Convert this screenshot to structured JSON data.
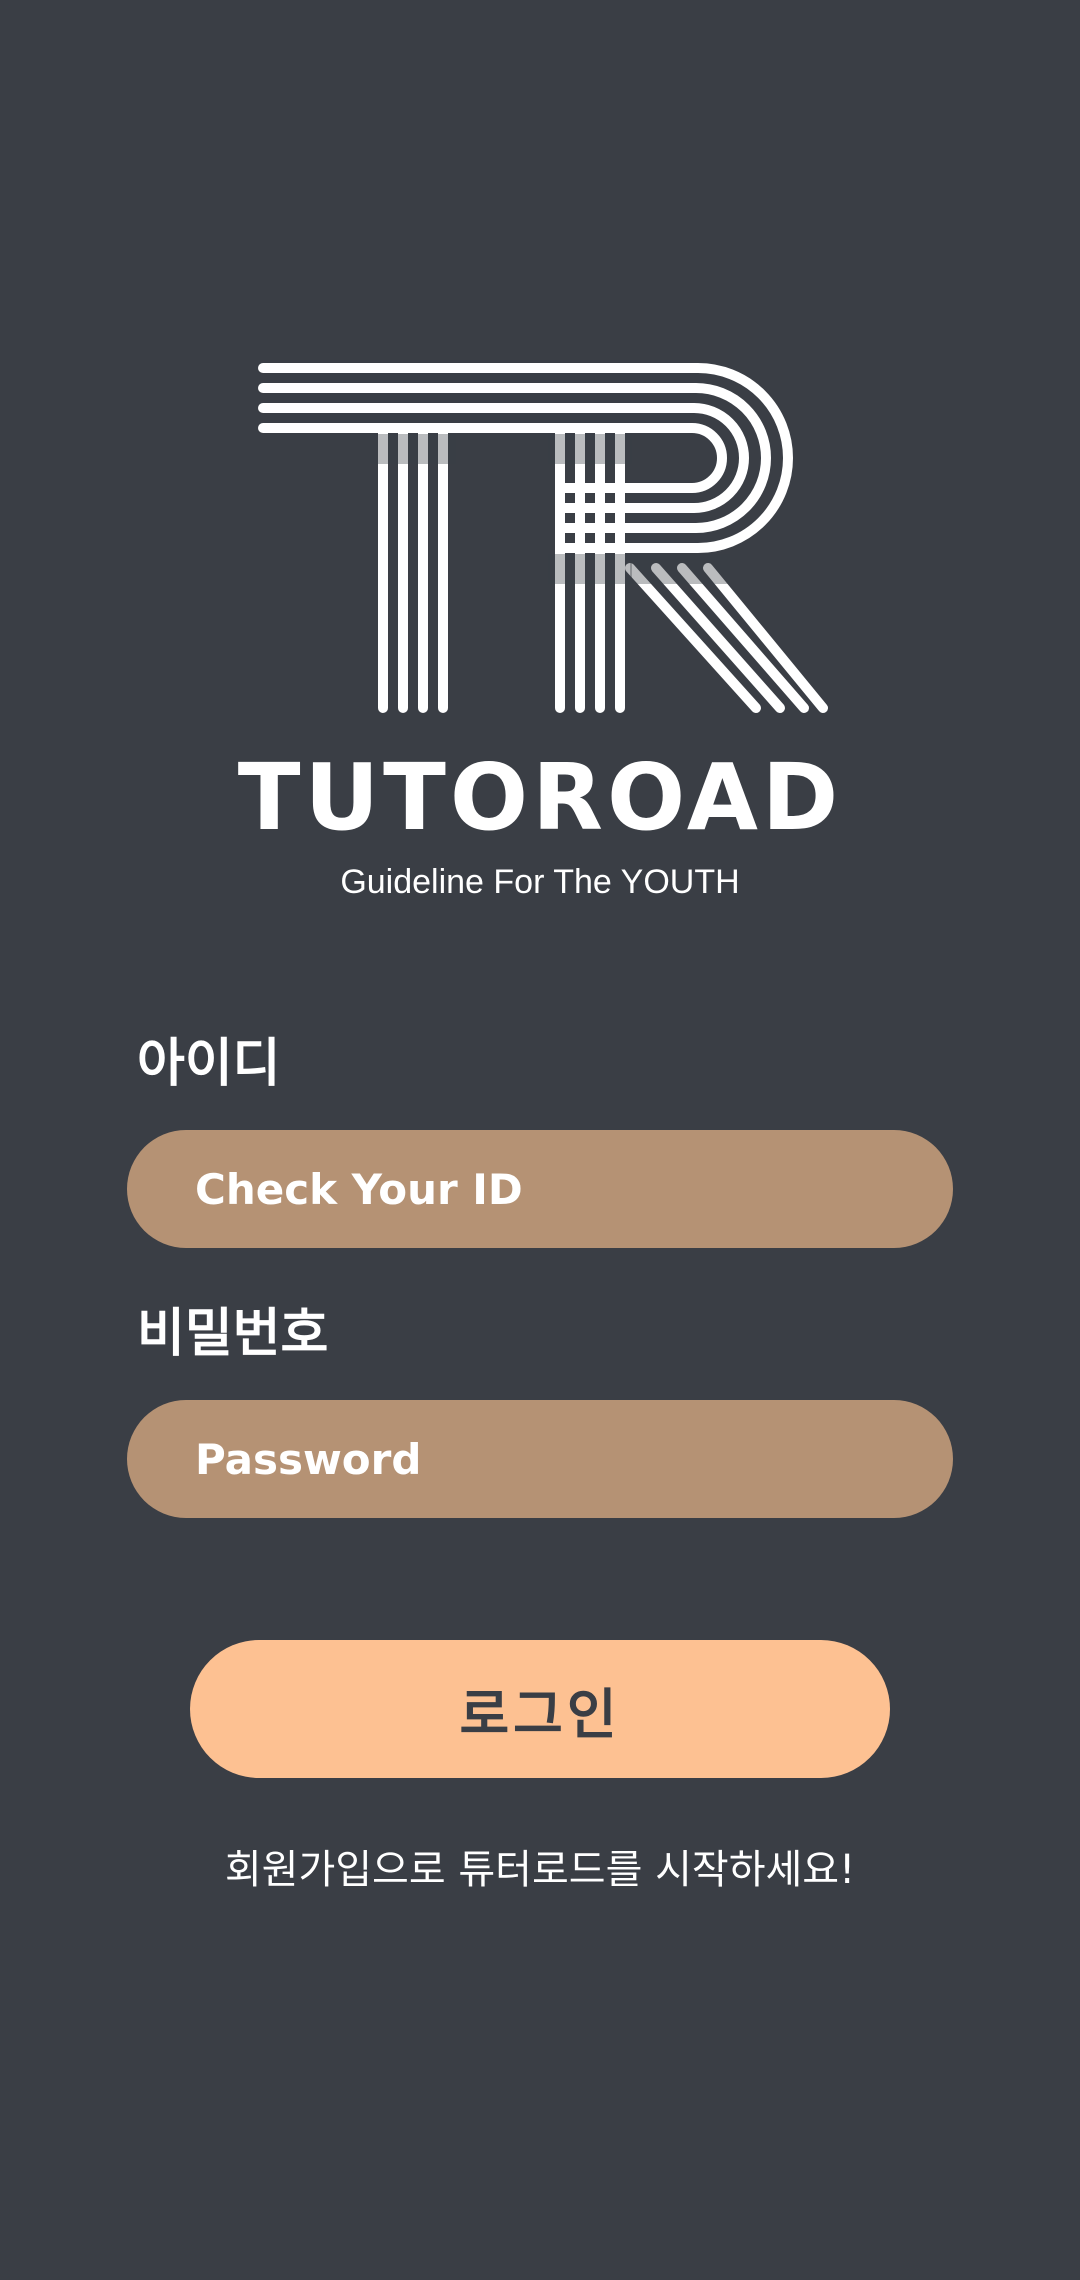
{
  "logo": {
    "icon": "tutoroad-tr-logo-icon",
    "name": "TUTOROAD",
    "tagline": "Guideline For The YOUTH"
  },
  "login_form": {
    "id_label": "아이디",
    "id_placeholder": "Check Your ID",
    "password_label": "비밀번호",
    "password_placeholder": "Password",
    "login_button": "로그인",
    "signup_link": "회원가입으로 튜터로드를 시작하세요!"
  },
  "colors": {
    "background": "#3a3e45",
    "input_fill": "#b59274",
    "button_fill": "#fdc192",
    "text": "#ffffff"
  }
}
